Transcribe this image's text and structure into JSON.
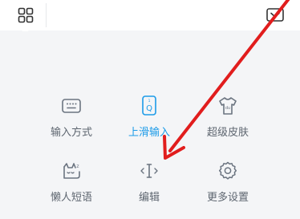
{
  "toolbar": {
    "menu_icon": "grid-four-squares-icon",
    "collapse_icon": "keyboard-collapse-icon"
  },
  "panel": {
    "items": [
      {
        "label": "输入方式",
        "icon": "keyboard-icon",
        "active": false
      },
      {
        "label": "上滑输入",
        "icon": "swipe-up-key-icon",
        "active": true
      },
      {
        "label": "超级皮肤",
        "icon": "tshirt-skin-icon",
        "active": false
      },
      {
        "label": "懒人短语",
        "icon": "lazy-cat-phrase-icon",
        "active": false
      },
      {
        "label": "编辑",
        "icon": "text-cursor-edit-icon",
        "active": false
      },
      {
        "label": "更多设置",
        "icon": "gear-icon",
        "active": false
      }
    ]
  },
  "annotation": {
    "color": "#e11d1d"
  },
  "colors": {
    "accent": "#1c9be8",
    "icon_gray": "#6b7480",
    "label_gray": "#5e6670",
    "panel_bg": "#f4f5f7"
  }
}
